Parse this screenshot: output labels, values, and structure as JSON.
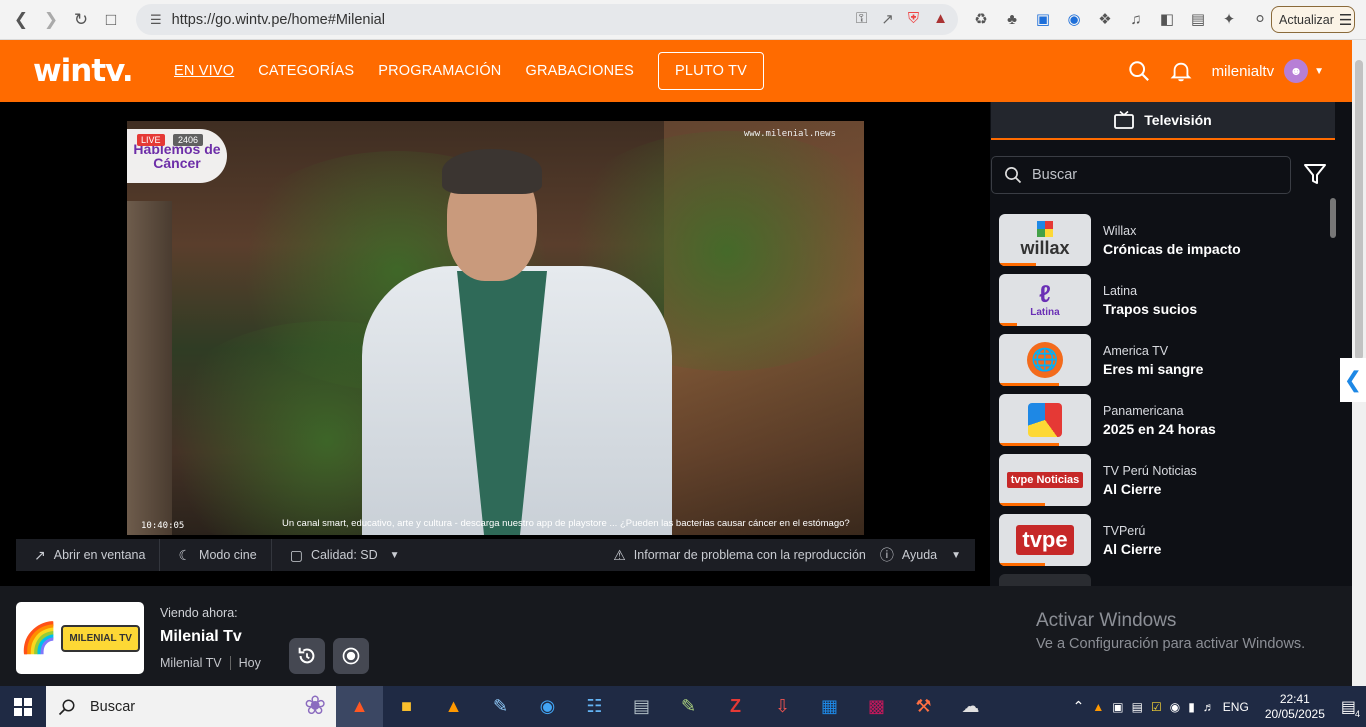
{
  "browser": {
    "url": "https://go.wintv.pe/home#Milenial",
    "update_label": "Actualizar"
  },
  "header": {
    "logo": "wintv.",
    "nav": [
      {
        "label": "EN VIVO"
      },
      {
        "label": "CATEGORÍAS"
      },
      {
        "label": "PROGRAMACIÓN"
      },
      {
        "label": "GRABACIONES"
      },
      {
        "label": "PLUTO TV"
      }
    ],
    "username": "milenialtv",
    "accent": "#ff6b00"
  },
  "video": {
    "live_label": "LIVE",
    "views": "2406",
    "show_logo": "Hablemos de Cáncer",
    "watermark": "www.milenial.news",
    "timecode": "10:40:05",
    "ticker": "Un canal smart, educativo, arte y cultura - descarga nuestro app de playstore ... ¿Pueden las bacterias causar cáncer en el estómago?"
  },
  "controls": {
    "open_window": "Abrir en ventana",
    "cinema_mode": "Modo cine",
    "quality": "Calidad: SD",
    "report": "Informar de problema con la reproducción",
    "help": "Ayuda"
  },
  "sidebar": {
    "tab_label": "Televisión",
    "search_placeholder": "Buscar",
    "channels": [
      {
        "name": "Willax",
        "program": "Crónicas de impacto",
        "logo": "willax",
        "progress": 0.4
      },
      {
        "name": "Latina",
        "program": "Trapos sucios",
        "logo": "Latina",
        "progress": 0.2
      },
      {
        "name": "America TV",
        "program": "Eres mi sangre",
        "logo": "america",
        "progress": 0.65
      },
      {
        "name": "Panamericana",
        "program": "2025 en 24 horas",
        "logo": "panamericana",
        "progress": 0.65
      },
      {
        "name": "TV Perú Noticias",
        "program": "Al Cierre",
        "logo": "tvpe Noticias",
        "progress": 0.5
      },
      {
        "name": "TVPerú",
        "program": "Al Cierre",
        "logo": "tvpe",
        "progress": 0.5
      }
    ]
  },
  "now_playing": {
    "label": "Viendo ahora:",
    "title": "Milenial Tv",
    "channel": "Milenial TV",
    "day": "Hoy",
    "thumb_logo": "MILENIAL TV"
  },
  "windows": {
    "activate_title": "Activar Windows",
    "activate_sub": "Ve a Configuración para activar Windows.",
    "search_label": "Buscar",
    "lang": "ENG",
    "time": "22:41",
    "date": "20/05/2025",
    "notifications": "4"
  }
}
